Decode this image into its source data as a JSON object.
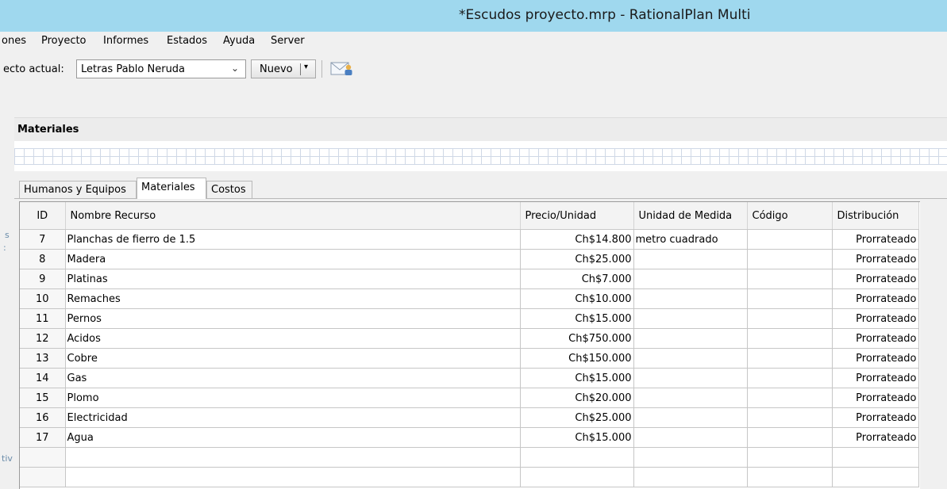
{
  "window": {
    "title": "*Escudos proyecto.mrp - RationalPlan Multi"
  },
  "menu": [
    "ones",
    "Proyecto",
    "Informes",
    "Estados",
    "Ayuda",
    "Server"
  ],
  "toolbar": {
    "project_label": "ecto actual:",
    "project_value": "Letras Pablo Neruda",
    "new_label": "Nuevo"
  },
  "section": {
    "title": "Materiales"
  },
  "tabs": [
    {
      "label": "Humanos y Equipos",
      "active": false
    },
    {
      "label": "Materiales",
      "active": true
    },
    {
      "label": "Costos",
      "active": false
    }
  ],
  "table": {
    "columns": [
      "ID",
      "Nombre Recurso",
      "Precio/Unidad",
      "Unidad de Medida",
      "Código",
      "Distribución"
    ],
    "rows": [
      [
        "7",
        "Planchas de fierro de 1.5",
        "Ch$14.800",
        "metro cuadrado",
        "",
        "Prorrateado"
      ],
      [
        "8",
        "Madera",
        "Ch$25.000",
        "",
        "",
        "Prorrateado"
      ],
      [
        "9",
        "Platinas",
        "Ch$7.000",
        "",
        "",
        "Prorrateado"
      ],
      [
        "10",
        "Remaches",
        "Ch$10.000",
        "",
        "",
        "Prorrateado"
      ],
      [
        "11",
        "Pernos",
        "Ch$15.000",
        "",
        "",
        "Prorrateado"
      ],
      [
        "12",
        "Acidos",
        "Ch$750.000",
        "",
        "",
        "Prorrateado"
      ],
      [
        "13",
        "Cobre",
        "Ch$150.000",
        "",
        "",
        "Prorrateado"
      ],
      [
        "14",
        "Gas",
        "Ch$15.000",
        "",
        "",
        "Prorrateado"
      ],
      [
        "15",
        "Plomo",
        "Ch$20.000",
        "",
        "",
        "Prorrateado"
      ],
      [
        "16",
        "Electricidad",
        "Ch$25.000",
        "",
        "",
        "Prorrateado"
      ],
      [
        "17",
        "Agua",
        "Ch$15.000",
        "",
        "",
        "Prorrateado"
      ]
    ],
    "empty_rows": 2
  },
  "left_edge_fragments": [
    "s",
    ":",
    "tiv"
  ]
}
